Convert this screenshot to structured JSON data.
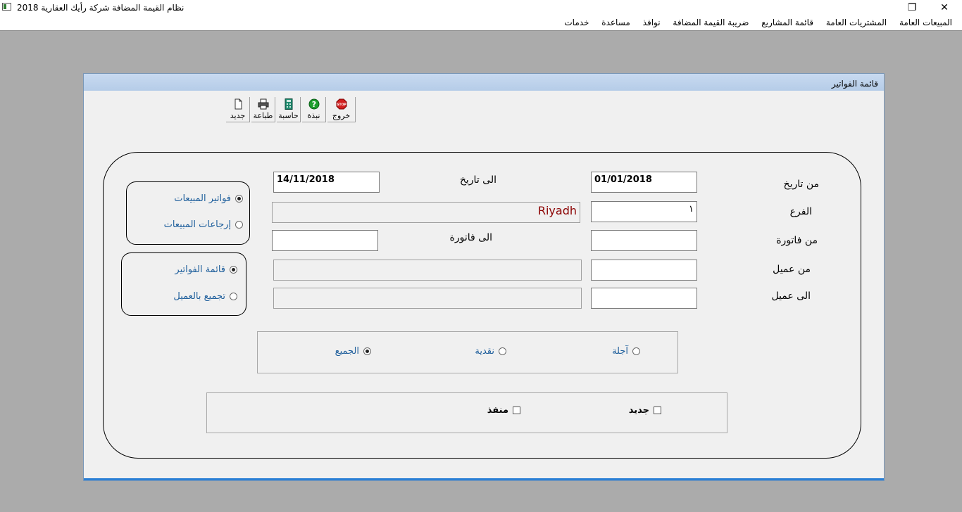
{
  "app": {
    "title": "نظام القيمة المضافة  شركة رأيك العقارية  2018",
    "restore_glyph": "❐",
    "close_glyph": "✕"
  },
  "menu": {
    "items": [
      "المبيعات العامة",
      "المشتريات العامة",
      "قائمة المشاريع",
      "ضريبة القيمة المضافة",
      "نوافذ",
      "مساعدة",
      "خدمات"
    ]
  },
  "window": {
    "title": "قائمة الفواتير"
  },
  "toolbar": {
    "exit": "خروج",
    "about": "نبذة",
    "calculator": "حاسبة",
    "print": "طباعة",
    "new": "جديد",
    "stop_text": "STOP"
  },
  "form": {
    "from_date_label": "من تاريخ",
    "from_date_value": "01/01/2018",
    "to_date_label": "الى تاريخ",
    "to_date_value": "14/11/2018",
    "branch_label": "الفرع",
    "branch_code": "١",
    "branch_name": "Riyadh",
    "from_invoice_label": "من فاتورة",
    "from_invoice_value": "",
    "to_invoice_label": "الى فاتورة",
    "to_invoice_value": "",
    "from_customer_label": "من عميل",
    "from_customer_value": "",
    "from_customer_name": "",
    "to_customer_label": "الى عميل",
    "to_customer_value": "",
    "to_customer_name": ""
  },
  "invoice_type": {
    "sales_invoices": "فواتير المبيعات",
    "sales_returns": "إرجاعات المبيعات",
    "selected": "sales_invoices"
  },
  "report_type": {
    "invoice_list": "قائمة الفواتير",
    "group_by_customer": "تجميع بالعميل",
    "selected": "invoice_list"
  },
  "payment_type": {
    "credit": "آجلة",
    "cash": "نقدية",
    "all": "الجميع",
    "selected": "all"
  },
  "status": {
    "new": "جديد",
    "executed": "منفذ",
    "new_checked": false,
    "executed_checked": false
  },
  "colors": {
    "branch_name": "#8b0000",
    "radio_text": "#1f5f9c",
    "caption_gradient_top": "#c8daf0",
    "desktop": "#ababab"
  }
}
